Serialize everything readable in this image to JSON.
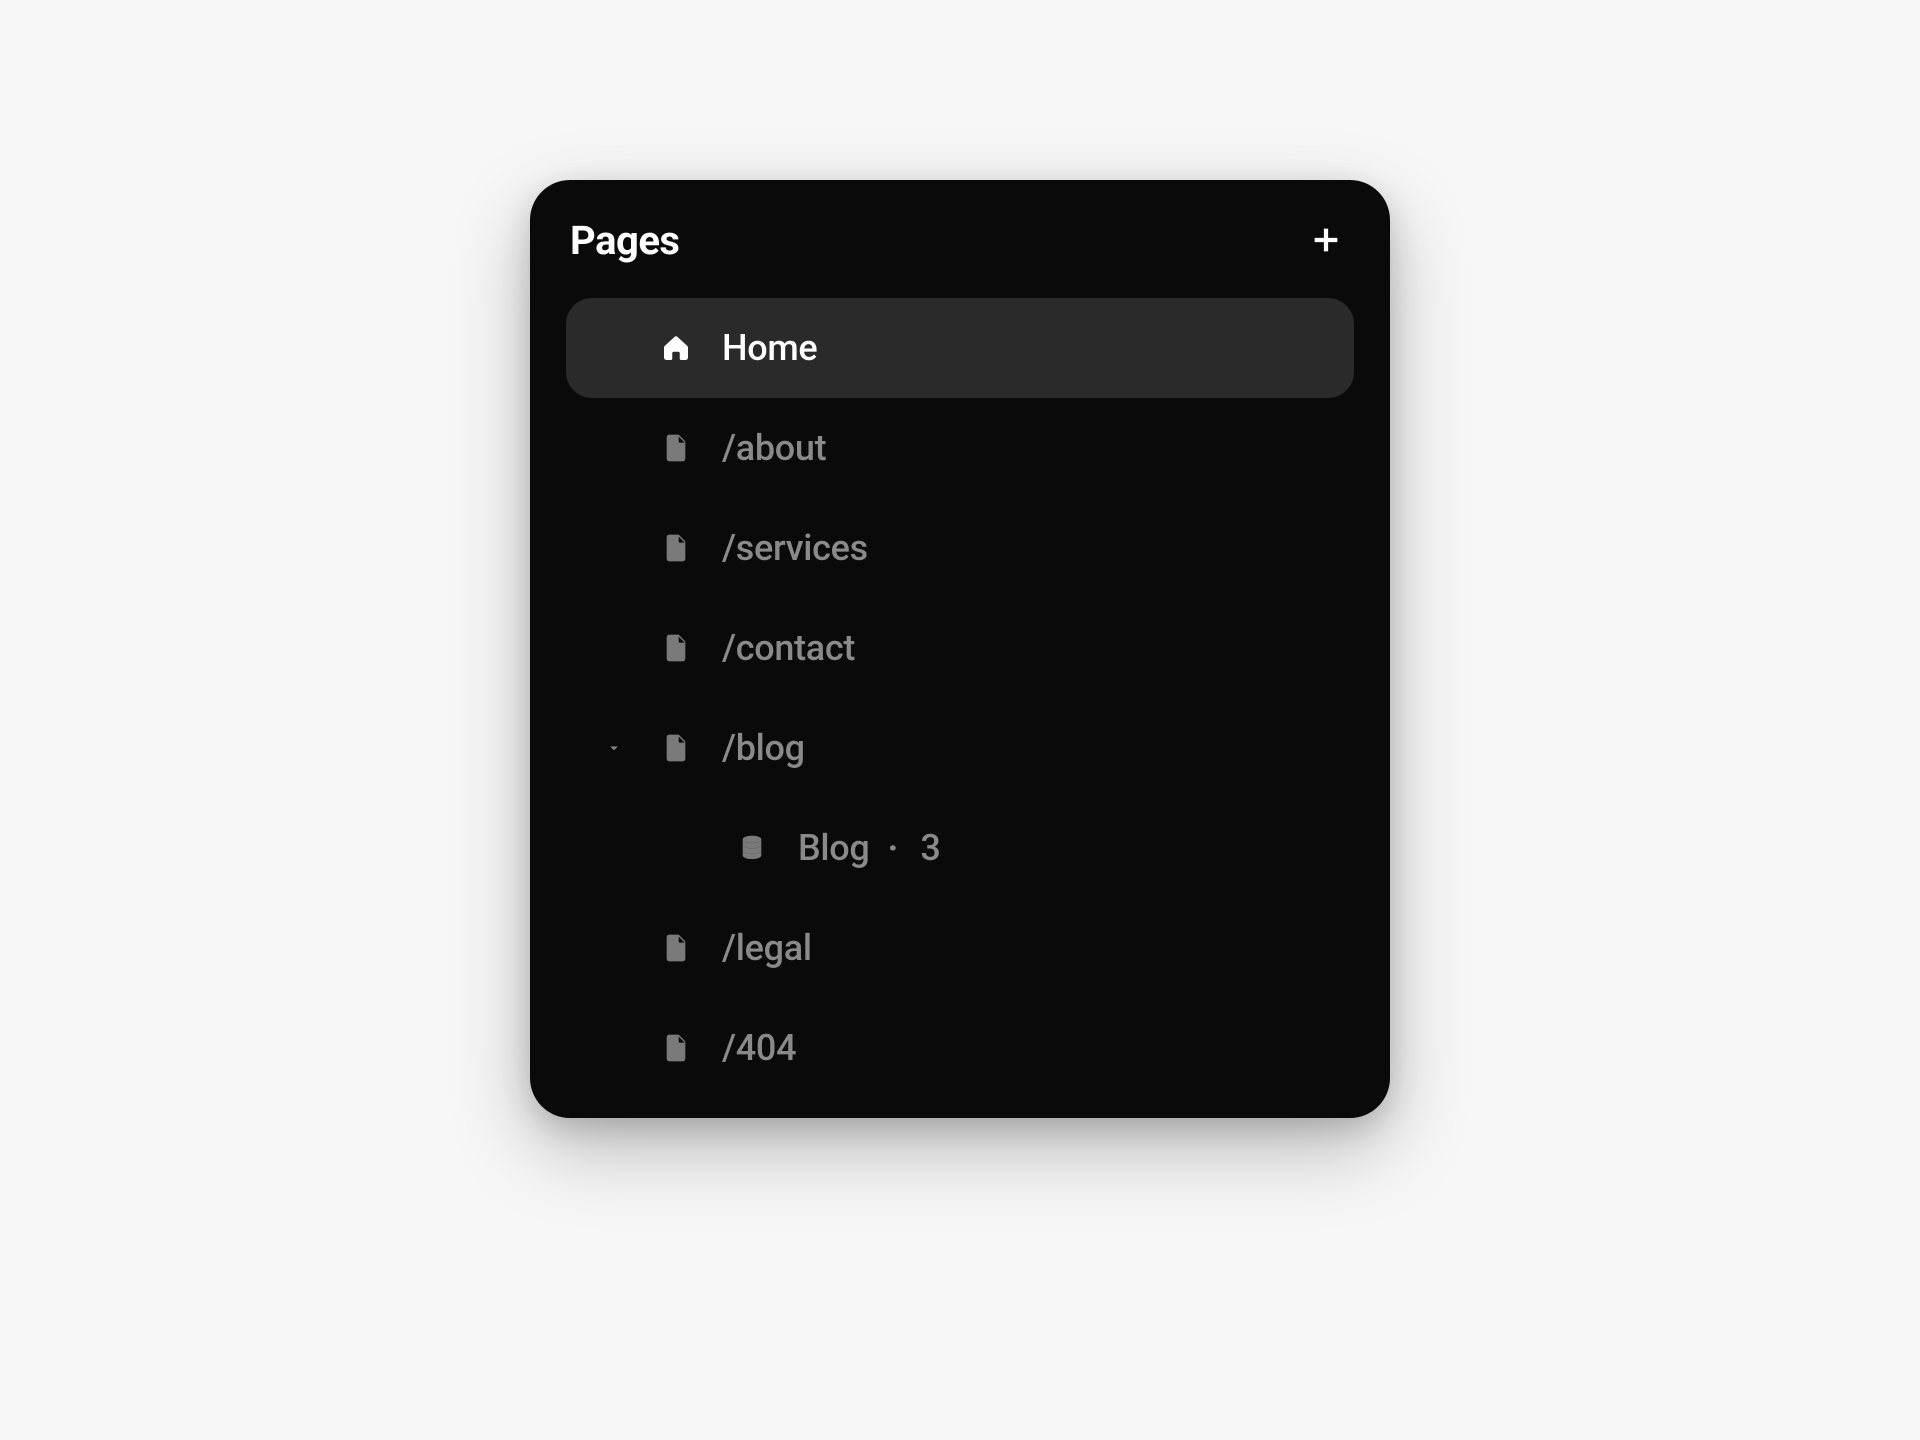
{
  "panel": {
    "title": "Pages"
  },
  "pages": {
    "home": {
      "label": "Home"
    },
    "about": {
      "label": "/about"
    },
    "services": {
      "label": "/services"
    },
    "contact": {
      "label": "/contact"
    },
    "blog": {
      "label": "/blog"
    },
    "blog_collection": {
      "label": "Blog",
      "count": "3"
    },
    "legal": {
      "label": "/legal"
    },
    "notfound": {
      "label": "/404"
    }
  }
}
